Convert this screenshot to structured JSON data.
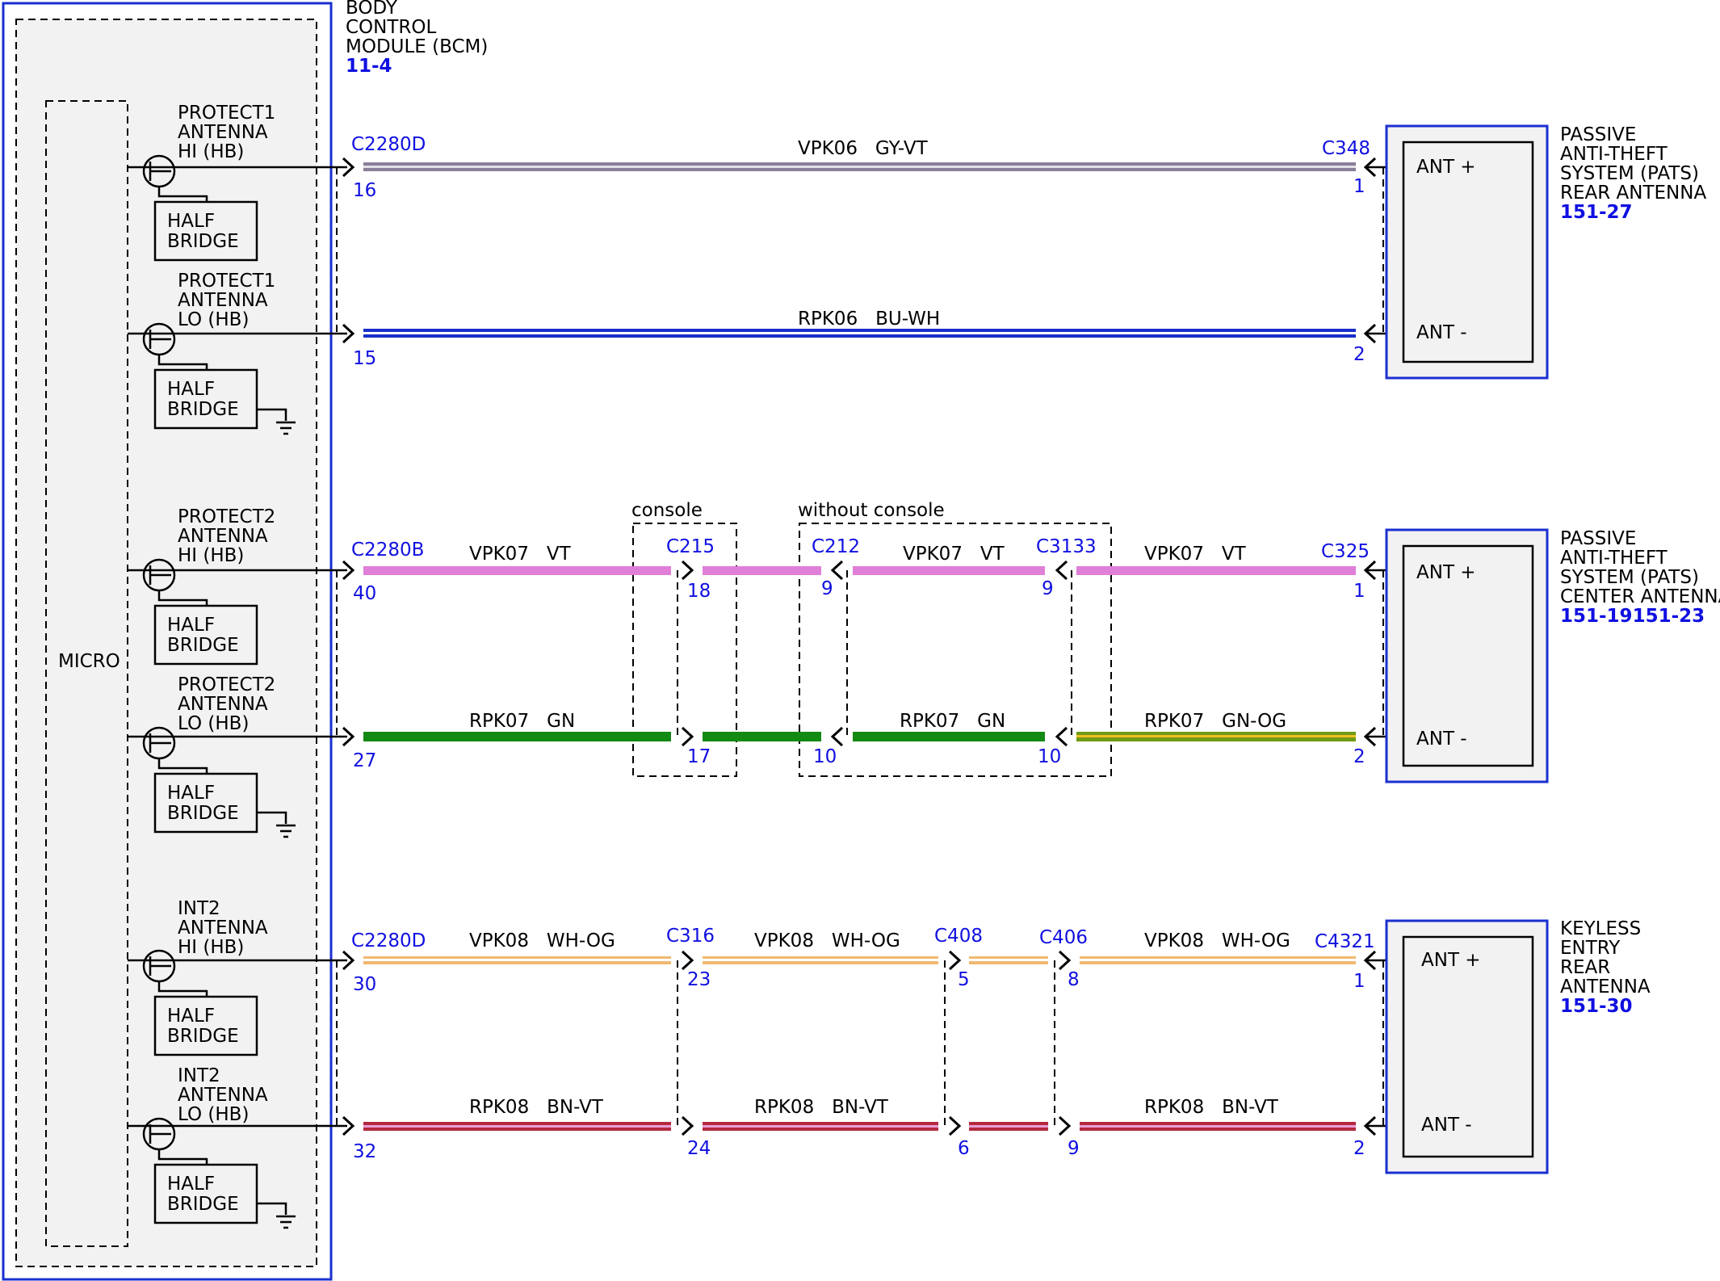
{
  "bcm": {
    "title_lines": [
      "BODY",
      "CONTROL",
      "MODULE (BCM)"
    ],
    "ref": "11-4",
    "micro_label": "MICRO",
    "half_bridge_lines": [
      "HALF",
      "BRIDGE"
    ],
    "pins": [
      {
        "lines": [
          "PROTECT1",
          "ANTENNA",
          "HI (HB)"
        ]
      },
      {
        "lines": [
          "PROTECT1",
          "ANTENNA",
          "LO (HB)"
        ]
      },
      {
        "lines": [
          "PROTECT2",
          "ANTENNA",
          "HI (HB)"
        ]
      },
      {
        "lines": [
          "PROTECT2",
          "ANTENNA",
          "LO (HB)"
        ]
      },
      {
        "lines": [
          "INT2",
          "ANTENNA",
          "HI (HB)"
        ]
      },
      {
        "lines": [
          "INT2",
          "ANTENNA",
          "LO (HB)"
        ]
      }
    ]
  },
  "antennas": [
    {
      "title_lines": [
        "PASSIVE",
        "ANTI-THEFT",
        "SYSTEM (PATS)",
        "REAR ANTENNA"
      ],
      "ref": "151-27",
      "ant_plus": "ANT +",
      "ant_minus": "ANT -"
    },
    {
      "title_lines": [
        "PASSIVE",
        "ANTI-THEFT",
        "SYSTEM (PATS)",
        "CENTER ANTENNA"
      ],
      "ref": "151-19151-23",
      "ant_plus": "ANT +",
      "ant_minus": "ANT -"
    },
    {
      "title_lines": [
        "KEYLESS",
        "ENTRY",
        "REAR",
        "ANTENNA"
      ],
      "ref": "151-30",
      "ant_plus": "ANT +",
      "ant_minus": "ANT -"
    }
  ],
  "options": {
    "console": "console",
    "without_console": "without console"
  },
  "connectors": {
    "c2280d_a": "C2280D",
    "c348": "C348",
    "c2280b": "C2280B",
    "c215": "C215",
    "c212": "C212",
    "c3133": "C3133",
    "c325": "C325",
    "c2280d_b": "C2280D",
    "c316": "C316",
    "c408": "C408",
    "c406": "C406",
    "c4321": "C4321"
  },
  "circuits": [
    {
      "labels": [
        "VPK06 GY-VT"
      ],
      "pins": [
        "16",
        "1"
      ]
    },
    {
      "labels": [
        "RPK06 BU-WH"
      ],
      "pins": [
        "15",
        "2"
      ]
    },
    {
      "labels": [
        "VPK07 VT",
        "VPK07 VT",
        "VPK07 VT"
      ],
      "pins": [
        "40",
        "18",
        "9",
        "9",
        "1"
      ]
    },
    {
      "labels": [
        "RPK07 GN",
        "RPK07 GN",
        "RPK07 GN-OG"
      ],
      "pins": [
        "27",
        "17",
        "10",
        "10",
        "2"
      ]
    },
    {
      "labels": [
        "VPK08 WH-OG",
        "VPK08 WH-OG",
        "VPK08 WH-OG"
      ],
      "pins": [
        "30",
        "23",
        "5",
        "8",
        "1"
      ]
    },
    {
      "labels": [
        "RPK08 BN-VT",
        "RPK08 BN-VT",
        "RPK08 BN-VT"
      ],
      "pins": [
        "32",
        "24",
        "6",
        "9",
        "2"
      ]
    }
  ],
  "colors": {
    "GY-VT": "#8a7f9a",
    "BU-WH": "#1a2fc8",
    "VT": "#e07fd8",
    "GN": "#138a13",
    "GN-OG": "#6f9b14",
    "WH-OG": "#f0b870",
    "BN-VT": "#b5293f",
    "border_blue": "#1a2fd0"
  }
}
